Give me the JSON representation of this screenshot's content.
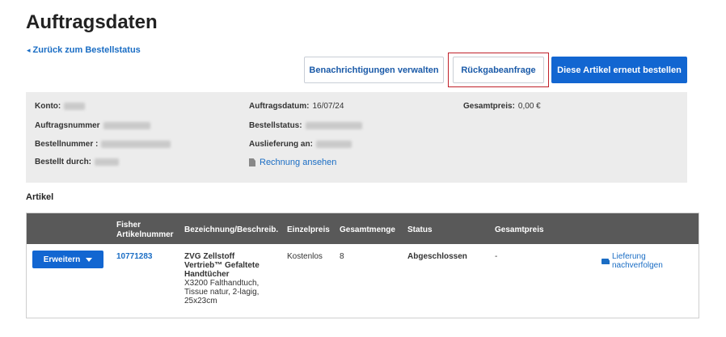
{
  "page": {
    "title": "Auftragsdaten"
  },
  "nav": {
    "back_label": "Zurück zum Bestellstatus"
  },
  "actions": {
    "notify_label": "Benachrichtigungen verwalten",
    "return_label": "Rückgabeanfrage",
    "reorder_label": "Diese Artikel erneut bestellen"
  },
  "order": {
    "account_label": "Konto:",
    "order_number_label": "Auftragsnummer",
    "bestellnummer_label": "Bestellnummer :",
    "ordered_by_label": "Bestellt durch:",
    "order_date_label": "Auftragsdatum:",
    "order_date_value": "16/07/24",
    "status_label": "Bestellstatus:",
    "delivery_label": "Auslieferung an:",
    "invoice_link": "Rechnung ansehen",
    "total_label": "Gesamtpreis:",
    "total_value": "0,00 €"
  },
  "items_section": {
    "title": "Artikel"
  },
  "table": {
    "headers": {
      "fisher_line1": "Fisher",
      "fisher_line2": "Artikelnummer",
      "description": "Bezeichnung/Beschreib.",
      "unit_price": "Einzelpreis",
      "quantity": "Gesamtmenge",
      "status": "Status",
      "total_price": "Gesamtpreis"
    },
    "row": {
      "expand_label": "Erweitern",
      "article_number": "10771283",
      "name_line1": "ZVG Zellstoff",
      "name_line2": "Vertrieb™ Gefaltete",
      "name_line3": "Handtücher",
      "desc_line1": "X3200 Falthandtuch,",
      "desc_line2": "Tissue natur, 2-lagig,",
      "desc_line3": "25x23cm",
      "unit_price": "Kostenlos",
      "quantity": "8",
      "status": "Abgeschlossen",
      "total_price": "-",
      "track_label": "Lieferung nachverfolgen"
    }
  },
  "colors": {
    "primary": "#1266d1",
    "link": "#1a6dc4",
    "header_bg": "#595959",
    "info_bg": "#ececec",
    "highlight": "#c0202a"
  }
}
